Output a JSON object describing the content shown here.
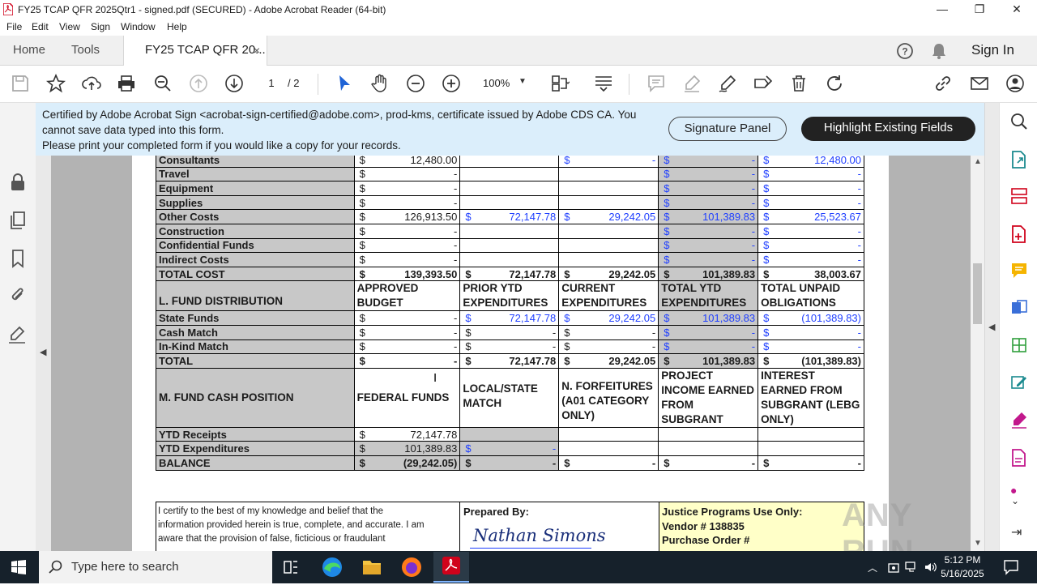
{
  "window": {
    "title": "FY25 TCAP QFR 2025Qtr1 - signed.pdf (SECURED) - Adobe Acrobat Reader (64-bit)",
    "minimize": "—",
    "maximize": "❐",
    "close": "✕"
  },
  "menu": [
    "File",
    "Edit",
    "View",
    "Sign",
    "Window",
    "Help"
  ],
  "tabs": {
    "home": "Home",
    "tools": "Tools",
    "document": "FY25 TCAP QFR 20...",
    "close": "×",
    "sign_in": "Sign In"
  },
  "toolbar": {
    "page_current": "1",
    "page_total": "/ 2",
    "zoom": "100%"
  },
  "cert_bar": {
    "line1": "Certified by Adobe Acrobat Sign <acrobat-sign-certified@adobe.com>, prod-kms, certificate issued by Adobe CDS CA.  You",
    "line2": "cannot save data typed into this form.",
    "line3": "Please print your completed form if you would like a copy for your records.",
    "signature_panel": "Signature Panel",
    "highlight_fields": "Highlight Existing Fields"
  },
  "cost_rows": [
    {
      "label": "Consultants",
      "c1": "12,480.00",
      "c2": "",
      "c3": "-",
      "c4": "-",
      "c5": "12,480.00"
    },
    {
      "label": "Travel",
      "c1": "-",
      "c2": "",
      "c3": "",
      "c4": "-",
      "c5": "-"
    },
    {
      "label": "Equipment",
      "c1": "-",
      "c2": "",
      "c3": "",
      "c4": "-",
      "c5": "-"
    },
    {
      "label": "Supplies",
      "c1": "-",
      "c2": "",
      "c3": "",
      "c4": "-",
      "c5": "-"
    },
    {
      "label": "Other Costs",
      "c1": "126,913.50",
      "c2": "72,147.78",
      "c3": "29,242.05",
      "c4": "101,389.83",
      "c5": "25,523.67"
    },
    {
      "label": "Construction",
      "c1": "-",
      "c2": "",
      "c3": "",
      "c4": "-",
      "c5": "-"
    },
    {
      "label": "Confidential Funds",
      "c1": "-",
      "c2": "",
      "c3": "",
      "c4": "-",
      "c5": "-"
    },
    {
      "label": "Indirect Costs",
      "c1": "-",
      "c2": "",
      "c3": "",
      "c4": "-",
      "c5": "-"
    }
  ],
  "total_cost": {
    "label": "TOTAL COST",
    "c1": "139,393.50",
    "c2": "72,147.78",
    "c3": "29,242.05",
    "c4": "101,389.83",
    "c5": "38,003.67"
  },
  "fund_dist": {
    "title": "L.  FUND DISTRIBUTION",
    "headers": [
      "APPROVED BUDGET",
      "PRIOR YTD EXPENDITURES",
      "CURRENT EXPENDITURES",
      "TOTAL YTD EXPENDITURES",
      "TOTAL UNPAID OBLIGATIONS"
    ],
    "rows": [
      {
        "label": "State Funds",
        "c1": "-",
        "c2": "72,147.78",
        "c3": "29,242.05",
        "c4": "101,389.83",
        "c5": "(101,389.83)"
      },
      {
        "label": "Cash Match",
        "c1": "-",
        "c2": "-",
        "c3": "-",
        "c4": "-",
        "c5": "-"
      },
      {
        "label": "In-Kind Match",
        "c1": "-",
        "c2": "-",
        "c3": "-",
        "c4": "-",
        "c5": "-"
      }
    ],
    "total": {
      "label": "TOTAL",
      "c1": "-",
      "c2": "72,147.78",
      "c3": "29,242.05",
      "c4": "101,389.83",
      "c5": "(101,389.83)"
    }
  },
  "cash_position": {
    "title": "M.  FUND CASH POSITION",
    "headers": [
      "FEDERAL FUNDS",
      "LOCAL/STATE MATCH",
      "N.  FORFEITURES (A01 CATEGORY ONLY)",
      "PROJECT INCOME EARNED FROM SUBGRANT",
      "INTEREST EARNED FROM SUBGRANT (LEBG ONLY)"
    ],
    "rows": [
      {
        "label": "YTD Receipts",
        "c1": "72,147.78"
      },
      {
        "label": "YTD Expenditures",
        "c1": "101,389.83",
        "c2": "-"
      },
      {
        "label": "BALANCE",
        "c1": "(29,242.05)",
        "c2": "-",
        "c3": "-",
        "c4": "-",
        "c5": "-"
      }
    ]
  },
  "dollar": "$",
  "certify": {
    "text1": "I certify to the best of my knowledge and belief that the",
    "text2": "information provided herein is true, complete, and accurate. I am",
    "text3": "aware that the provision of false, ficticious or fraudulant",
    "prepared_by": "Prepared By:",
    "signature": "Nathan Simons",
    "jp_use": "Justice Programs Use Only:",
    "vendor": "Vendor # 138835",
    "po": "Purchase Order #"
  },
  "watermark": "ANY RUN",
  "taskbar": {
    "search_placeholder": "Type here to search",
    "time": "5:12 PM",
    "date": "5/16/2025"
  },
  "colors": {
    "cert_bar": "#dbeefb",
    "accent_blue": "#1f3fff",
    "acrobat_red": "#d0021b",
    "table_gray": "#c8c8c8",
    "taskbar": "#16212b"
  }
}
